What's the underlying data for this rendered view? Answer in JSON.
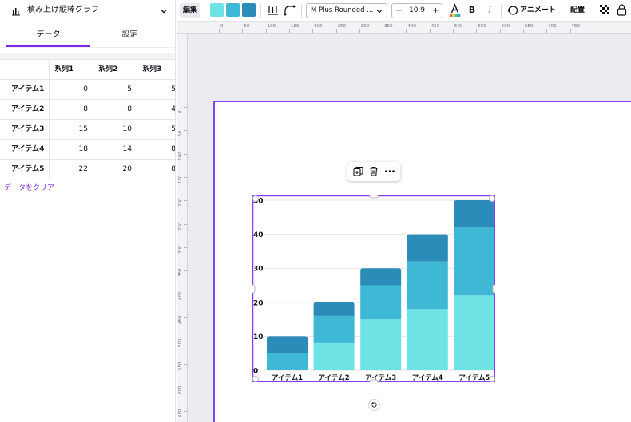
{
  "panel": {
    "title": "積み上げ縦棒グラフ",
    "tabs": [
      {
        "label": "データ"
      },
      {
        "label": "設定"
      }
    ],
    "table": {
      "headers": [
        "系列1",
        "系列2",
        "系列3"
      ],
      "rows": [
        {
          "label": "アイテム1",
          "values": [
            "0",
            "5",
            "5"
          ]
        },
        {
          "label": "アイテム2",
          "values": [
            "8",
            "8",
            "4"
          ]
        },
        {
          "label": "アイテム3",
          "values": [
            "15",
            "10",
            "5"
          ]
        },
        {
          "label": "アイテム4",
          "values": [
            "18",
            "14",
            "8"
          ]
        },
        {
          "label": "アイテム5",
          "values": [
            "22",
            "20",
            "8"
          ]
        }
      ]
    },
    "clear_label": "データをクリア"
  },
  "toolbar": {
    "edit_label": "編集",
    "swatches": [
      "#6ee3e6",
      "#3fb8d6",
      "#2b8bb9"
    ],
    "font_name": "M Plus Rounded ...",
    "font_size": "10.9",
    "minus_label": "−",
    "plus_label": "+",
    "bold_label": "B",
    "italic_label": "I",
    "animate_label": "アニメート",
    "position_label": "配置"
  },
  "ruler": {
    "h_ticks": [
      "0",
      "50",
      "100",
      "150",
      "200",
      "250",
      "300",
      "350",
      "400",
      "450",
      "500",
      "550",
      "600",
      "650",
      "700",
      "750"
    ],
    "v_ticks": [
      "0",
      "50",
      "100",
      "150",
      "200",
      "250",
      "300",
      "350",
      "400",
      "450",
      "500",
      "550",
      "600",
      "650"
    ]
  },
  "colors": {
    "accent": "#8b3dff",
    "series1": "#6ee3e6",
    "series2": "#3fb8d6",
    "series3": "#2b8bb9"
  },
  "chart_data": {
    "type": "bar",
    "stacked": true,
    "categories": [
      "アイテム1",
      "アイテム2",
      "アイテム3",
      "アイテム4",
      "アイテム5"
    ],
    "series": [
      {
        "name": "系列1",
        "values": [
          0,
          8,
          15,
          18,
          22
        ],
        "color": "#6ee3e6"
      },
      {
        "name": "系列2",
        "values": [
          5,
          8,
          10,
          14,
          20
        ],
        "color": "#3fb8d6"
      },
      {
        "name": "系列3",
        "values": [
          5,
          4,
          5,
          8,
          8
        ],
        "color": "#2b8bb9"
      }
    ],
    "yticks": [
      "0",
      "10",
      "20",
      "30",
      "40",
      "50"
    ],
    "ylim": [
      0,
      50
    ],
    "grid": true,
    "legend": "none"
  }
}
